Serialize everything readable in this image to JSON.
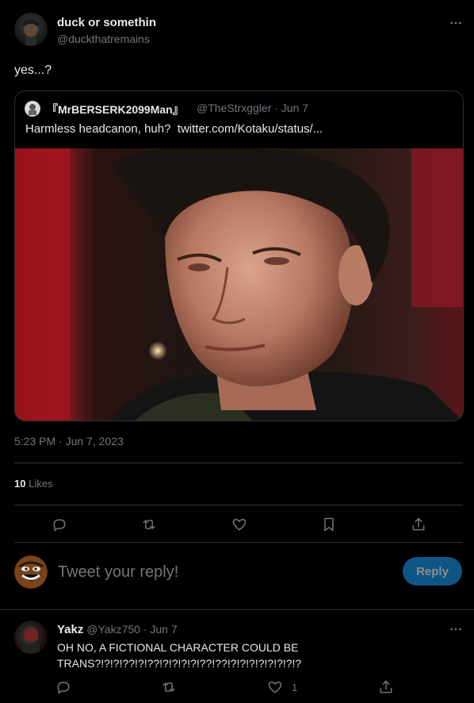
{
  "main_tweet": {
    "display_name": "duck or somethin",
    "handle": "@duckthatremains",
    "text": "yes...?",
    "timestamp": "5:23 PM · Jun 7, 2023",
    "likes_count": "10",
    "likes_label": "Likes"
  },
  "quoted_tweet": {
    "display_name": "『MrBERSERK2099Man』",
    "handle": "@TheStrxggler",
    "date": "· Jun 7",
    "text": "Harmless headcanon, huh?",
    "link": "twitter.com/Kotaku/status/..."
  },
  "actions": {
    "icons": [
      "reply-icon",
      "retweet-icon",
      "like-icon",
      "bookmark-icon",
      "share-icon"
    ]
  },
  "composer": {
    "placeholder": "Tweet your reply!",
    "reply_button": "Reply"
  },
  "reply_tweet": {
    "display_name": "Yakz",
    "handle": "@Yakz750",
    "date": "· Jun 7",
    "text_line1": "OH NO, A FICTIONAL CHARACTER COULD BE",
    "text_line2": "TRANS?!?!?!??!?!??!?!?!?!?!??!??!?!?!?!?!?!?!?!?",
    "like_count": "1"
  },
  "colors": {
    "background": "#000000",
    "text": "#e7e9ea",
    "muted": "#71767b",
    "border": "#2f3336",
    "reply_button": "#1d9bf0"
  }
}
